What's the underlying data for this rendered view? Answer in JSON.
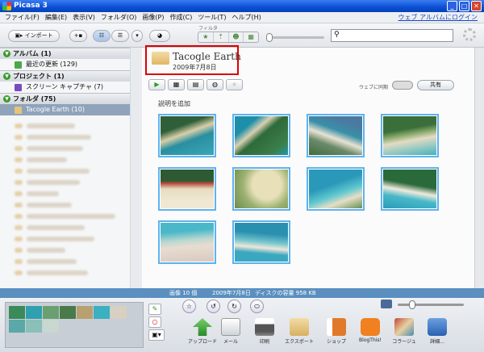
{
  "window": {
    "title": "Picasa 3"
  },
  "menu": [
    "ファイル(F)",
    "編集(E)",
    "表示(V)",
    "フォルダ(O)",
    "画像(P)",
    "作成(C)",
    "ツール(T)",
    "ヘルプ(H)"
  ],
  "weblink": "ウェブ アルバムにログイン",
  "toolbar": {
    "import": "インポート",
    "filter_label": "フィルタ",
    "search_placeholder": ""
  },
  "sidebar": {
    "albums_header": "アルバム (1)",
    "albums": [
      {
        "label": "最近の更新 (129)"
      }
    ],
    "projects_header": "プロジェクト (1)",
    "projects": [
      {
        "label": "スクリーン キャプチャ (7)"
      }
    ],
    "folders_header": "フォルダ (75)",
    "folders": [
      {
        "label": "Tacogle Earth (10)"
      }
    ]
  },
  "album": {
    "title": "Tacogle Earth",
    "date": "2009年7月8日",
    "caption_prompt": "説明を追加",
    "sync_label": "ウェブに同期",
    "share_label": "共有"
  },
  "status": {
    "count": "画像 10 個",
    "date": "2009年7月8日",
    "disk": "ディスクの容量 958 KB"
  },
  "actions": [
    {
      "label": "アップロード"
    },
    {
      "label": "メール"
    },
    {
      "label": "印刷"
    },
    {
      "label": "エクスポート"
    },
    {
      "label": "ショップ"
    },
    {
      "label": "BlogThis!"
    },
    {
      "label": "コラージュ"
    },
    {
      "label": "詳細..."
    }
  ],
  "colors": {
    "accent": "#5fb2f0",
    "title_blue": "#0a4fd6",
    "highlight": "#dd0000"
  }
}
